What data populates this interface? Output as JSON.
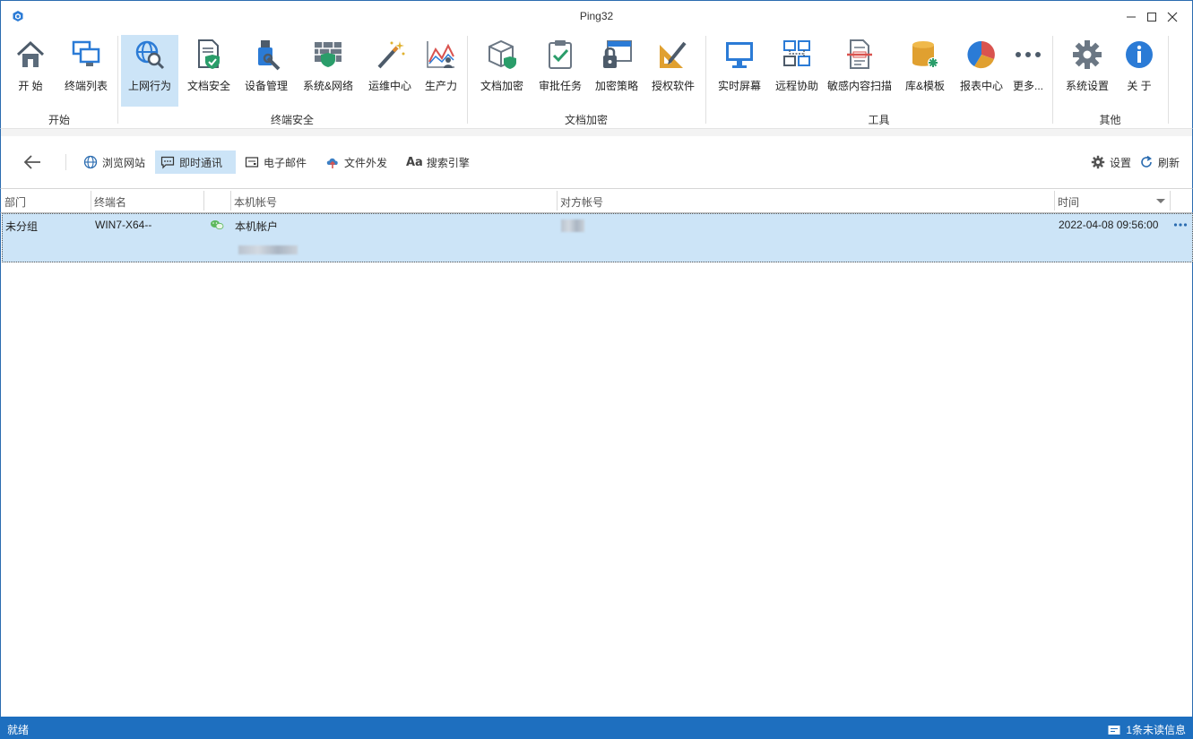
{
  "window": {
    "title": "Ping32"
  },
  "ribbon": {
    "buttons": [
      {
        "label": "开 始",
        "icon": "home-icon"
      },
      {
        "label": "终端列表",
        "icon": "monitors-icon"
      },
      {
        "label": "上网行为",
        "icon": "globe-search-icon"
      },
      {
        "label": "文档安全",
        "icon": "document-shield-icon"
      },
      {
        "label": "设备管理",
        "icon": "usb-device-icon"
      },
      {
        "label": "系统&网络",
        "icon": "firewall-icon"
      },
      {
        "label": "运维中心",
        "icon": "magic-wand-icon"
      },
      {
        "label": "生产力",
        "icon": "chart-person-icon"
      },
      {
        "label": "文档加密",
        "icon": "box-shield-icon"
      },
      {
        "label": "审批任务",
        "icon": "clipboard-check-icon"
      },
      {
        "label": "加密策略",
        "icon": "window-lock-icon"
      },
      {
        "label": "授权软件",
        "icon": "ruler-pencil-icon"
      },
      {
        "label": "实时屏幕",
        "icon": "monitor-icon"
      },
      {
        "label": "远程协助",
        "icon": "remote-network-icon"
      },
      {
        "label": "敏感内容扫描",
        "icon": "document-scan-icon"
      },
      {
        "label": "库&模板",
        "icon": "database-icon"
      },
      {
        "label": "报表中心",
        "icon": "pie-chart-icon"
      },
      {
        "label": "更多...",
        "icon": "more-dots-icon"
      },
      {
        "label": "系统设置",
        "icon": "gear-icon"
      },
      {
        "label": "关 于",
        "icon": "info-icon"
      }
    ],
    "groups": [
      "开始",
      "终端安全",
      "文档加密",
      "工具",
      "其他"
    ]
  },
  "subtoolbar": {
    "items": [
      "浏览网站",
      "即时通讯",
      "电子邮件",
      "文件外发",
      "搜索引擎"
    ],
    "settings_label": "设置",
    "refresh_label": "刷新"
  },
  "table": {
    "columns": [
      "部门",
      "终端名",
      "本机帐号",
      "对方帐号",
      "时间"
    ],
    "rows": [
      {
        "dept": "未分组",
        "terminal": "WIN7-X64--",
        "local_account": "本机帐户",
        "time": "2022-04-08 09:56:00"
      }
    ]
  },
  "status": {
    "left": "就绪",
    "right": "1条未读信息"
  },
  "colors": {
    "accent": "#1e6fbf",
    "selection": "#cce4f7"
  }
}
